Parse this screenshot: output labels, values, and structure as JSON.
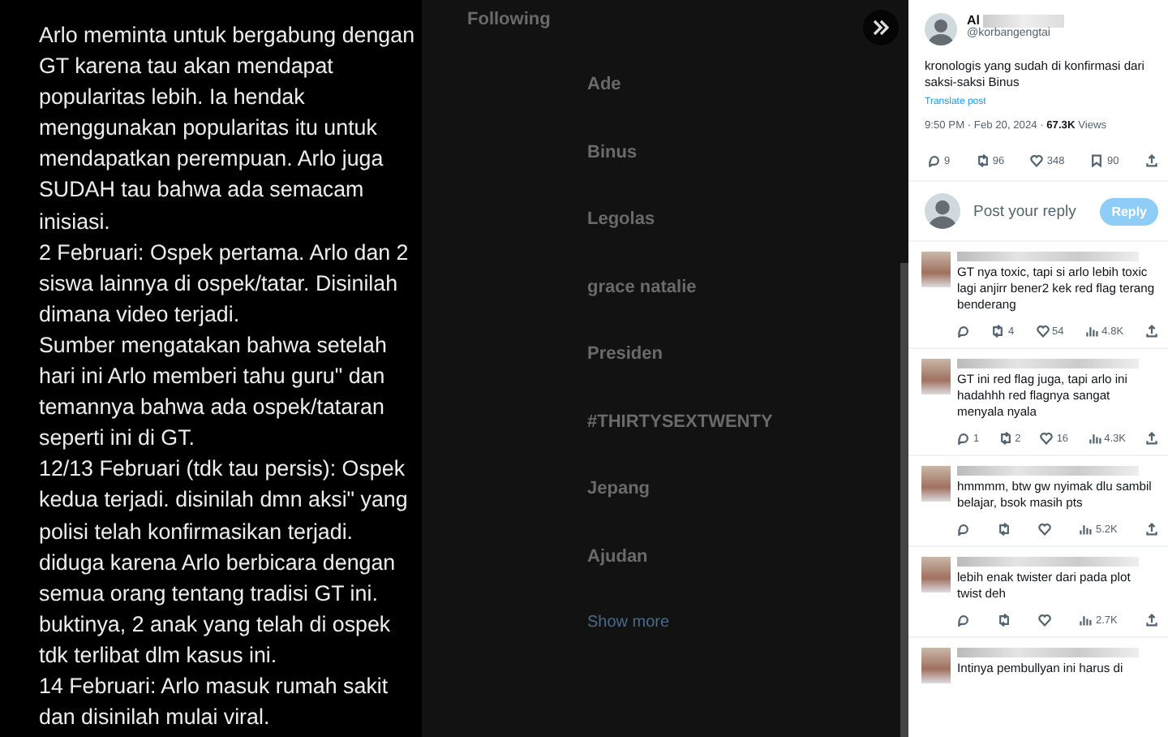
{
  "story": {
    "paragraphs": [
      "Arlo meminta untuk bergabung dengan GT karena tau akan mendapat popularitas lebih. Ia hendak menggunakan popularitas itu untuk mendapatkan perempuan. Arlo juga SUDAH tau bahwa ada semacam inisiasi.",
      "2 Februari: Ospek pertama. Arlo dan 2 siswa lainnya di ospek/tatar. Disinilah dimana video terjadi.",
      "Sumber mengatakan bahwa setelah hari ini Arlo memberi tahu guru\" dan temannya bahwa ada ospek/tataran seperti ini di GT.",
      "12/13 Februari (tdk tau persis): Ospek kedua terjadi. disinilah dmn aksi\" yang polisi telah konfirmasikan terjadi. diduga karena Arlo berbicara dengan semua orang tentang tradisi GT ini. buktinya, 2 anak yang telah di ospek tdk terlibat dlm kasus ini.",
      "14 Februari: Arlo masuk rumah sakit dan disinilah mulai viral."
    ]
  },
  "background": {
    "tab": "Following",
    "trends": [
      "Ade",
      "Binus",
      "Legolas",
      "grace natalie",
      "Presiden",
      "#THIRTYSEXTWENTY",
      "Jepang",
      "Ajudan"
    ],
    "show_more": "Show more"
  },
  "post": {
    "name": "Al",
    "handle": "@korbangengtai",
    "text": "kronologis yang sudah di konfirmasi dari saksi-saksi Binus",
    "translate": "Translate post",
    "time": "9:50 PM · Feb 20, 2024 · ",
    "views": "67.3K",
    "views_label": " Views",
    "actions": [
      {
        "kind": "reply",
        "count": "9"
      },
      {
        "kind": "repost",
        "count": "96"
      },
      {
        "kind": "like",
        "count": "348"
      },
      {
        "kind": "bookmark",
        "count": "90"
      }
    ]
  },
  "reply_box": {
    "placeholder": "Post your reply",
    "button": "Reply"
  },
  "replies": [
    {
      "text": "GT nya toxic, tapi si arlo lebih toxic lagi anjirr bener2 kek red flag terang benderang",
      "actions": [
        {
          "kind": "reply"
        },
        {
          "kind": "repost",
          "count": "4"
        },
        {
          "kind": "like",
          "count": "54"
        },
        {
          "kind": "views",
          "count": "4.8K"
        }
      ]
    },
    {
      "text": "GT ini red flag juga, tapi arlo ini hadahhh red flagnya sangat menyala nyala",
      "actions": [
        {
          "kind": "reply",
          "count": "1"
        },
        {
          "kind": "repost",
          "count": "2"
        },
        {
          "kind": "like",
          "count": "16"
        },
        {
          "kind": "views",
          "count": "4.3K"
        }
      ]
    },
    {
      "text": "hmmmm, btw gw nyimak dlu sambil belajar, bsok masih pts",
      "actions": [
        {
          "kind": "reply"
        },
        {
          "kind": "repost"
        },
        {
          "kind": "like"
        },
        {
          "kind": "views",
          "count": "5.2K"
        }
      ]
    },
    {
      "text": "lebih enak twister dari pada plot twist deh",
      "actions": [
        {
          "kind": "reply"
        },
        {
          "kind": "repost"
        },
        {
          "kind": "like"
        },
        {
          "kind": "views",
          "count": "2.7K"
        }
      ]
    },
    {
      "text": "Intinya pembullyan ini harus di"
    }
  ]
}
